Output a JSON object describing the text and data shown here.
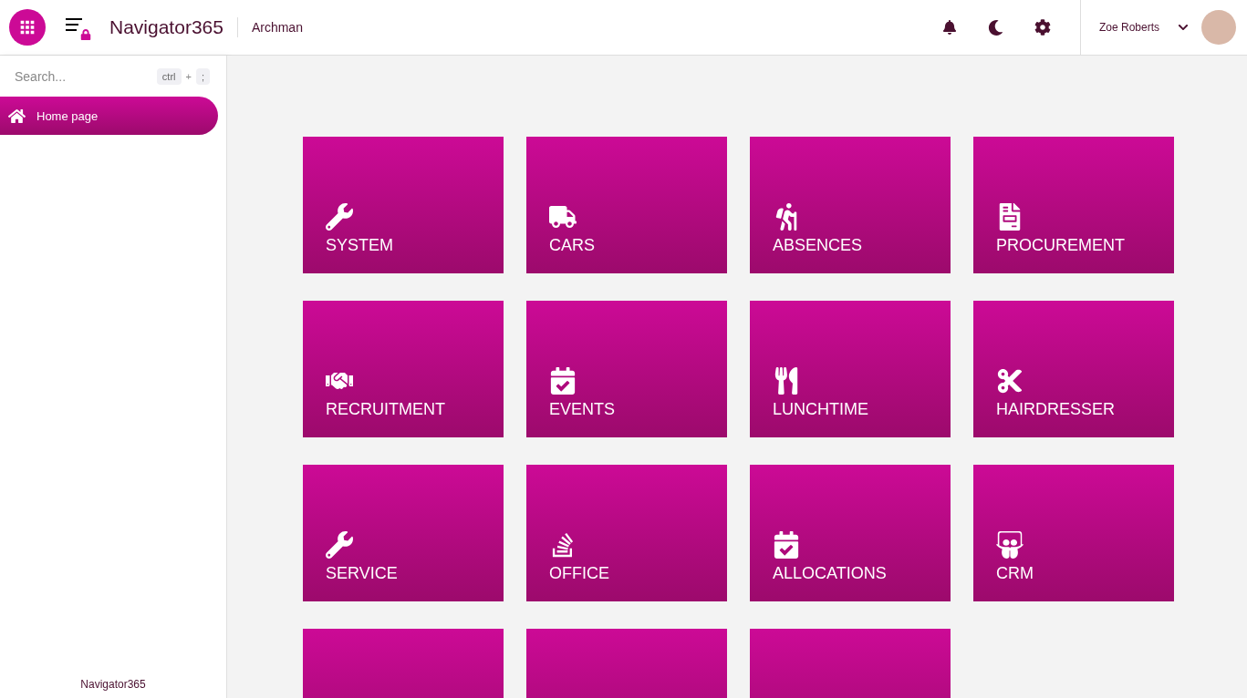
{
  "header": {
    "app_name": "Navigator365",
    "company": "Archman",
    "user_name": "Zoe Roberts"
  },
  "sidebar": {
    "search": {
      "placeholder": "Search...",
      "shortcut_keys": [
        "ctrl",
        "+",
        ";"
      ]
    },
    "items": [
      {
        "label": "Home page",
        "selected": true
      }
    ],
    "footer": "Navigator365"
  },
  "tiles": [
    {
      "label": "SYSTEM",
      "kind": "wrench"
    },
    {
      "label": "CARS",
      "kind": "truck"
    },
    {
      "label": "ABSENCES",
      "kind": "hiking"
    },
    {
      "label": "PROCUREMENT",
      "kind": "invoice"
    },
    {
      "label": "RECRUITMENT",
      "kind": "handshake"
    },
    {
      "label": "EVENTS",
      "kind": "calendar"
    },
    {
      "label": "LUNCHTIME",
      "kind": "utensils"
    },
    {
      "label": "HAIRDRESSER",
      "kind": "scissors"
    },
    {
      "label": "SERVICE",
      "kind": "wrench"
    },
    {
      "label": "OFFICE",
      "kind": "stack"
    },
    {
      "label": "ALLOCATIONS",
      "kind": "calendar"
    },
    {
      "label": "CRM",
      "kind": "slides"
    },
    {
      "kind": "blank"
    },
    {
      "kind": "blank"
    },
    {
      "kind": "blank"
    }
  ]
}
